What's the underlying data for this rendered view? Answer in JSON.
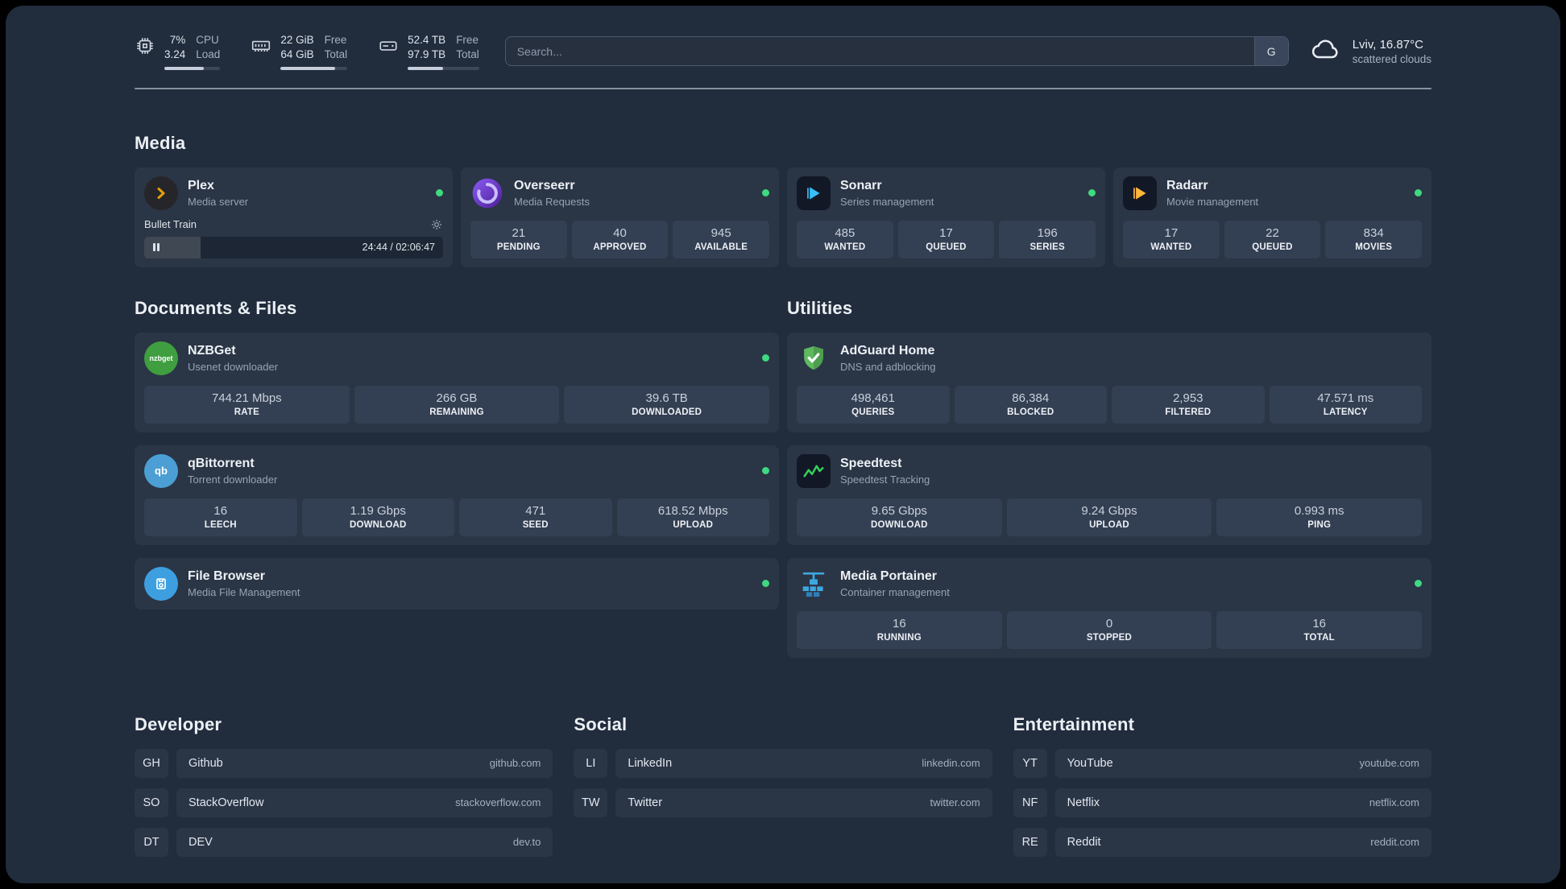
{
  "topbar": {
    "cpu": {
      "values": [
        "7%",
        "3.24"
      ],
      "labels": [
        "CPU",
        "Load"
      ],
      "percent": 70
    },
    "memory": {
      "values": [
        "22 GiB",
        "64 GiB"
      ],
      "labels": [
        "Free",
        "Total"
      ],
      "percent": 82
    },
    "disk": {
      "values": [
        "52.4 TB",
        "97.9 TB"
      ],
      "labels": [
        "Free",
        "Total"
      ],
      "percent": 50
    },
    "search": {
      "placeholder": "Search...",
      "provider_label": "G"
    },
    "weather": {
      "location": "Lviv, 16.87°C",
      "condition": "scattered clouds"
    }
  },
  "colors": {
    "status_online": "#3fd97f",
    "accent_plex": "#e5a00d"
  },
  "sections": {
    "media": {
      "title": "Media",
      "plex": {
        "title": "Plex",
        "subtitle": "Media server",
        "now_playing": "Bullet Train",
        "time": "24:44 / 02:06:47",
        "progress_percent": 19
      },
      "overseerr": {
        "title": "Overseerr",
        "subtitle": "Media Requests",
        "stats": [
          {
            "value": "21",
            "label": "PENDING"
          },
          {
            "value": "40",
            "label": "APPROVED"
          },
          {
            "value": "945",
            "label": "AVAILABLE"
          }
        ]
      },
      "sonarr": {
        "title": "Sonarr",
        "subtitle": "Series management",
        "stats": [
          {
            "value": "485",
            "label": "WANTED"
          },
          {
            "value": "17",
            "label": "QUEUED"
          },
          {
            "value": "196",
            "label": "SERIES"
          }
        ]
      },
      "radarr": {
        "title": "Radarr",
        "subtitle": "Movie management",
        "stats": [
          {
            "value": "17",
            "label": "WANTED"
          },
          {
            "value": "22",
            "label": "QUEUED"
          },
          {
            "value": "834",
            "label": "MOVIES"
          }
        ]
      }
    },
    "documents": {
      "title": "Documents & Files",
      "nzbget": {
        "title": "NZBGet",
        "subtitle": "Usenet downloader",
        "icon_text": "nzbget",
        "stats": [
          {
            "value": "744.21 Mbps",
            "label": "RATE"
          },
          {
            "value": "266 GB",
            "label": "REMAINING"
          },
          {
            "value": "39.6 TB",
            "label": "DOWNLOADED"
          }
        ]
      },
      "qbittorrent": {
        "title": "qBittorrent",
        "subtitle": "Torrent downloader",
        "icon_text": "qb",
        "stats": [
          {
            "value": "16",
            "label": "LEECH"
          },
          {
            "value": "1.19 Gbps",
            "label": "DOWNLOAD"
          },
          {
            "value": "471",
            "label": "SEED"
          },
          {
            "value": "618.52 Mbps",
            "label": "UPLOAD"
          }
        ]
      },
      "filebrowser": {
        "title": "File Browser",
        "subtitle": "Media File Management"
      }
    },
    "utilities": {
      "title": "Utilities",
      "adguard": {
        "title": "AdGuard Home",
        "subtitle": "DNS and adblocking",
        "stats": [
          {
            "value": "498,461",
            "label": "QUERIES"
          },
          {
            "value": "86,384",
            "label": "BLOCKED"
          },
          {
            "value": "2,953",
            "label": "FILTERED"
          },
          {
            "value": "47.571 ms",
            "label": "LATENCY"
          }
        ]
      },
      "speedtest": {
        "title": "Speedtest",
        "subtitle": "Speedtest Tracking",
        "stats": [
          {
            "value": "9.65 Gbps",
            "label": "DOWNLOAD"
          },
          {
            "value": "9.24 Gbps",
            "label": "UPLOAD"
          },
          {
            "value": "0.993 ms",
            "label": "PING"
          }
        ]
      },
      "portainer": {
        "title": "Media Portainer",
        "subtitle": "Container management",
        "stats": [
          {
            "value": "16",
            "label": "RUNNING"
          },
          {
            "value": "0",
            "label": "STOPPED"
          },
          {
            "value": "16",
            "label": "TOTAL"
          }
        ]
      }
    },
    "developer": {
      "title": "Developer",
      "links": [
        {
          "abbr": "GH",
          "name": "Github",
          "url": "github.com"
        },
        {
          "abbr": "SO",
          "name": "StackOverflow",
          "url": "stackoverflow.com"
        },
        {
          "abbr": "DT",
          "name": "DEV",
          "url": "dev.to"
        }
      ]
    },
    "social": {
      "title": "Social",
      "links": [
        {
          "abbr": "LI",
          "name": "LinkedIn",
          "url": "linkedin.com"
        },
        {
          "abbr": "TW",
          "name": "Twitter",
          "url": "twitter.com"
        }
      ]
    },
    "entertainment": {
      "title": "Entertainment",
      "links": [
        {
          "abbr": "YT",
          "name": "YouTube",
          "url": "youtube.com"
        },
        {
          "abbr": "NF",
          "name": "Netflix",
          "url": "netflix.com"
        },
        {
          "abbr": "RE",
          "name": "Reddit",
          "url": "reddit.com"
        }
      ]
    }
  }
}
